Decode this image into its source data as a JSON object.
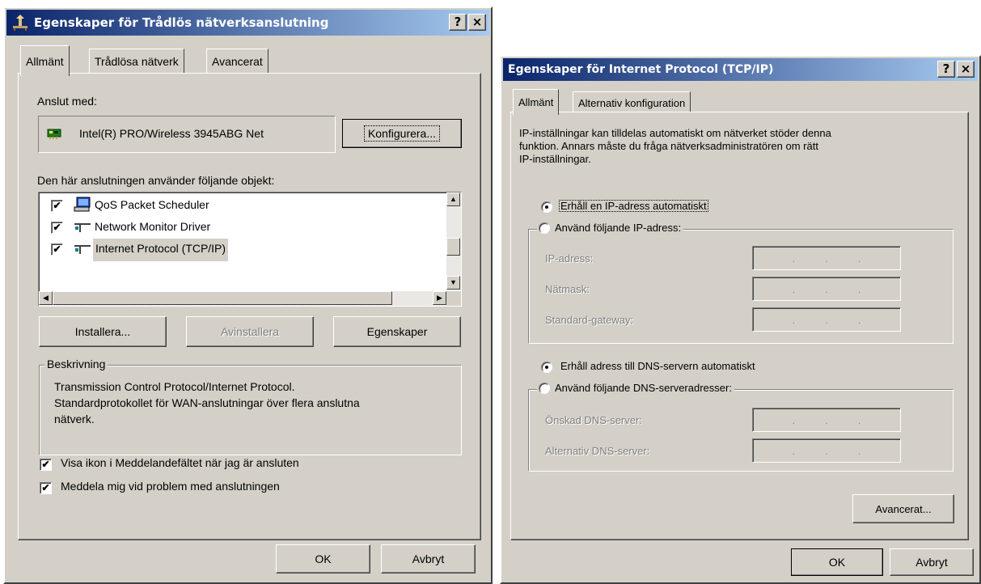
{
  "dialog1": {
    "title": "Egenskaper för Trådlös nätverksanslutning",
    "help_btn": "?",
    "close_btn": "×",
    "tabs": [
      "Allmänt",
      "Trådlösa nätverk",
      "Avancerat"
    ],
    "connect_using_label": "Anslut med:",
    "adapter_name": "Intel(R) PRO/Wireless 3945ABG Net",
    "configure_btn": "Konfigurera...",
    "items_label": "Den här anslutningen använder följande objekt:",
    "items": [
      {
        "label": "QoS Packet Scheduler",
        "checked": true,
        "icon": "scheduler-icon"
      },
      {
        "label": "Network Monitor Driver",
        "checked": true,
        "icon": "protocol-icon"
      },
      {
        "label": "Internet Protocol (TCP/IP)",
        "checked": true,
        "icon": "protocol-icon",
        "selected": true
      }
    ],
    "install_btn": "Installera...",
    "uninstall_btn": "Avinstallera",
    "properties_btn": "Egenskaper",
    "description_legend": "Beskrivning",
    "description_text_1": "Transmission Control Protocol/Internet Protocol.",
    "description_text_2": "Standardprotokollet för WAN-anslutningar över flera anslutna",
    "description_text_3": "nätverk.",
    "show_icon_label": "Visa ikon i Meddelandefältet när jag är ansluten",
    "notify_label": "Meddela mig vid problem med anslutningen",
    "ok_btn": "OK",
    "cancel_btn": "Avbryt"
  },
  "dialog2": {
    "title": "Egenskaper för Internet Protocol (TCP/IP)",
    "help_btn": "?",
    "close_btn": "×",
    "tabs": [
      "Allmänt",
      "Alternativ konfiguration"
    ],
    "intro_1": "IP-inställningar kan tilldelas automatiskt om nätverket stöder denna",
    "intro_2": "funktion. Annars måste du fråga nätverksadministratören om rätt",
    "intro_3": "IP-inställningar.",
    "auto_ip_label": "Erhåll en IP-adress automatiskt",
    "manual_ip_label": "Använd följande IP-adress:",
    "ip_address_label": "IP-adress:",
    "subnet_label": "Nätmask:",
    "gateway_label": "Standard-gateway:",
    "auto_dns_label": "Erhåll adress till DNS-servern automatiskt",
    "manual_dns_label": "Använd följande DNS-serveradresser:",
    "preferred_dns_label": "Önskad DNS-server:",
    "alternate_dns_label": "Alternativ DNS-server:",
    "ip_dot": ".",
    "advanced_btn": "Avancerat...",
    "ok_btn": "OK",
    "cancel_btn": "Avbryt"
  }
}
